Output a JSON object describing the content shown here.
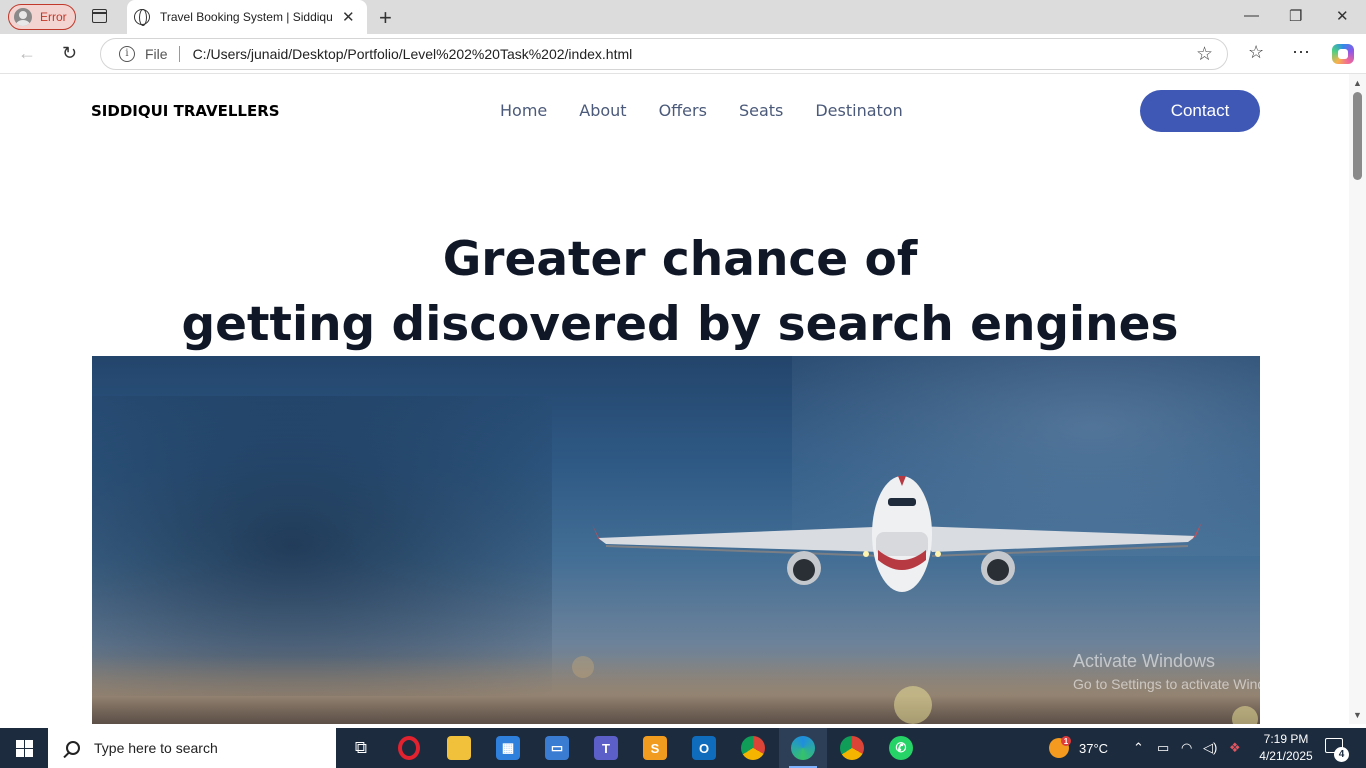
{
  "browser": {
    "profile_label": "Error",
    "tab_title": "Travel Booking System | Siddiqui",
    "tab_close": "✕",
    "new_tab": "+",
    "address_prefix": "File",
    "url": "C:/Users/junaid/Desktop/Portfolio/Level%202%20Task%202/index.html",
    "window_controls": {
      "minimize": "—",
      "restore": "❐",
      "close": "✕"
    }
  },
  "site": {
    "brand": "SIDDIQUI TRAVELLERS",
    "nav": [
      "Home",
      "About",
      "Offers",
      "Seats",
      "Destinaton"
    ],
    "contact_button": "Contact",
    "headline_line1": "Greater chance of",
    "headline_line2": "getting discovered by search engines",
    "hero_image": "airplane-takeoff-photo"
  },
  "watermark": {
    "line1": "Activate Windows",
    "line2": "Go to Settings to activate Windows."
  },
  "taskbar": {
    "search_placeholder": "Type here to search",
    "weather_temp": "37°C",
    "time": "7:19 PM",
    "date": "4/21/2025",
    "notification_count": "4",
    "weather_badge": "1"
  },
  "colors": {
    "contact_bg": "#3f58b5",
    "nav_text": "#4b5a7a",
    "headline": "#101827",
    "taskbar_bg": "#1c2b3e"
  }
}
